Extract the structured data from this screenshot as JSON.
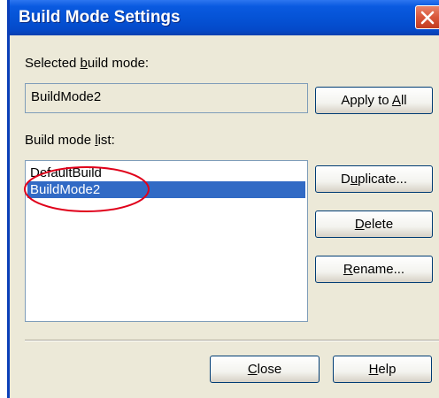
{
  "window": {
    "title": "Build Mode Settings"
  },
  "selected": {
    "label_pre": "Selected ",
    "label_u": "b",
    "label_post": "uild mode:",
    "value": "BuildMode2"
  },
  "list": {
    "label_pre": "Build mode ",
    "label_u": "l",
    "label_post": "ist:",
    "items": [
      "DefaultBuild",
      "BuildMode2"
    ],
    "selected_index": 1
  },
  "buttons": {
    "apply_pre": "Apply to ",
    "apply_u": "A",
    "apply_post": "ll",
    "duplicate_pre": "D",
    "duplicate_u": "u",
    "duplicate_post": "plicate...",
    "delete_u": "D",
    "delete_post": "elete",
    "rename_u": "R",
    "rename_post": "ename...",
    "close_u": "C",
    "close_post": "lose",
    "help_u": "H",
    "help_post": "elp"
  },
  "colors": {
    "titlebar": "#0553d6",
    "selection": "#316ac5",
    "annotation": "#e0001a"
  }
}
